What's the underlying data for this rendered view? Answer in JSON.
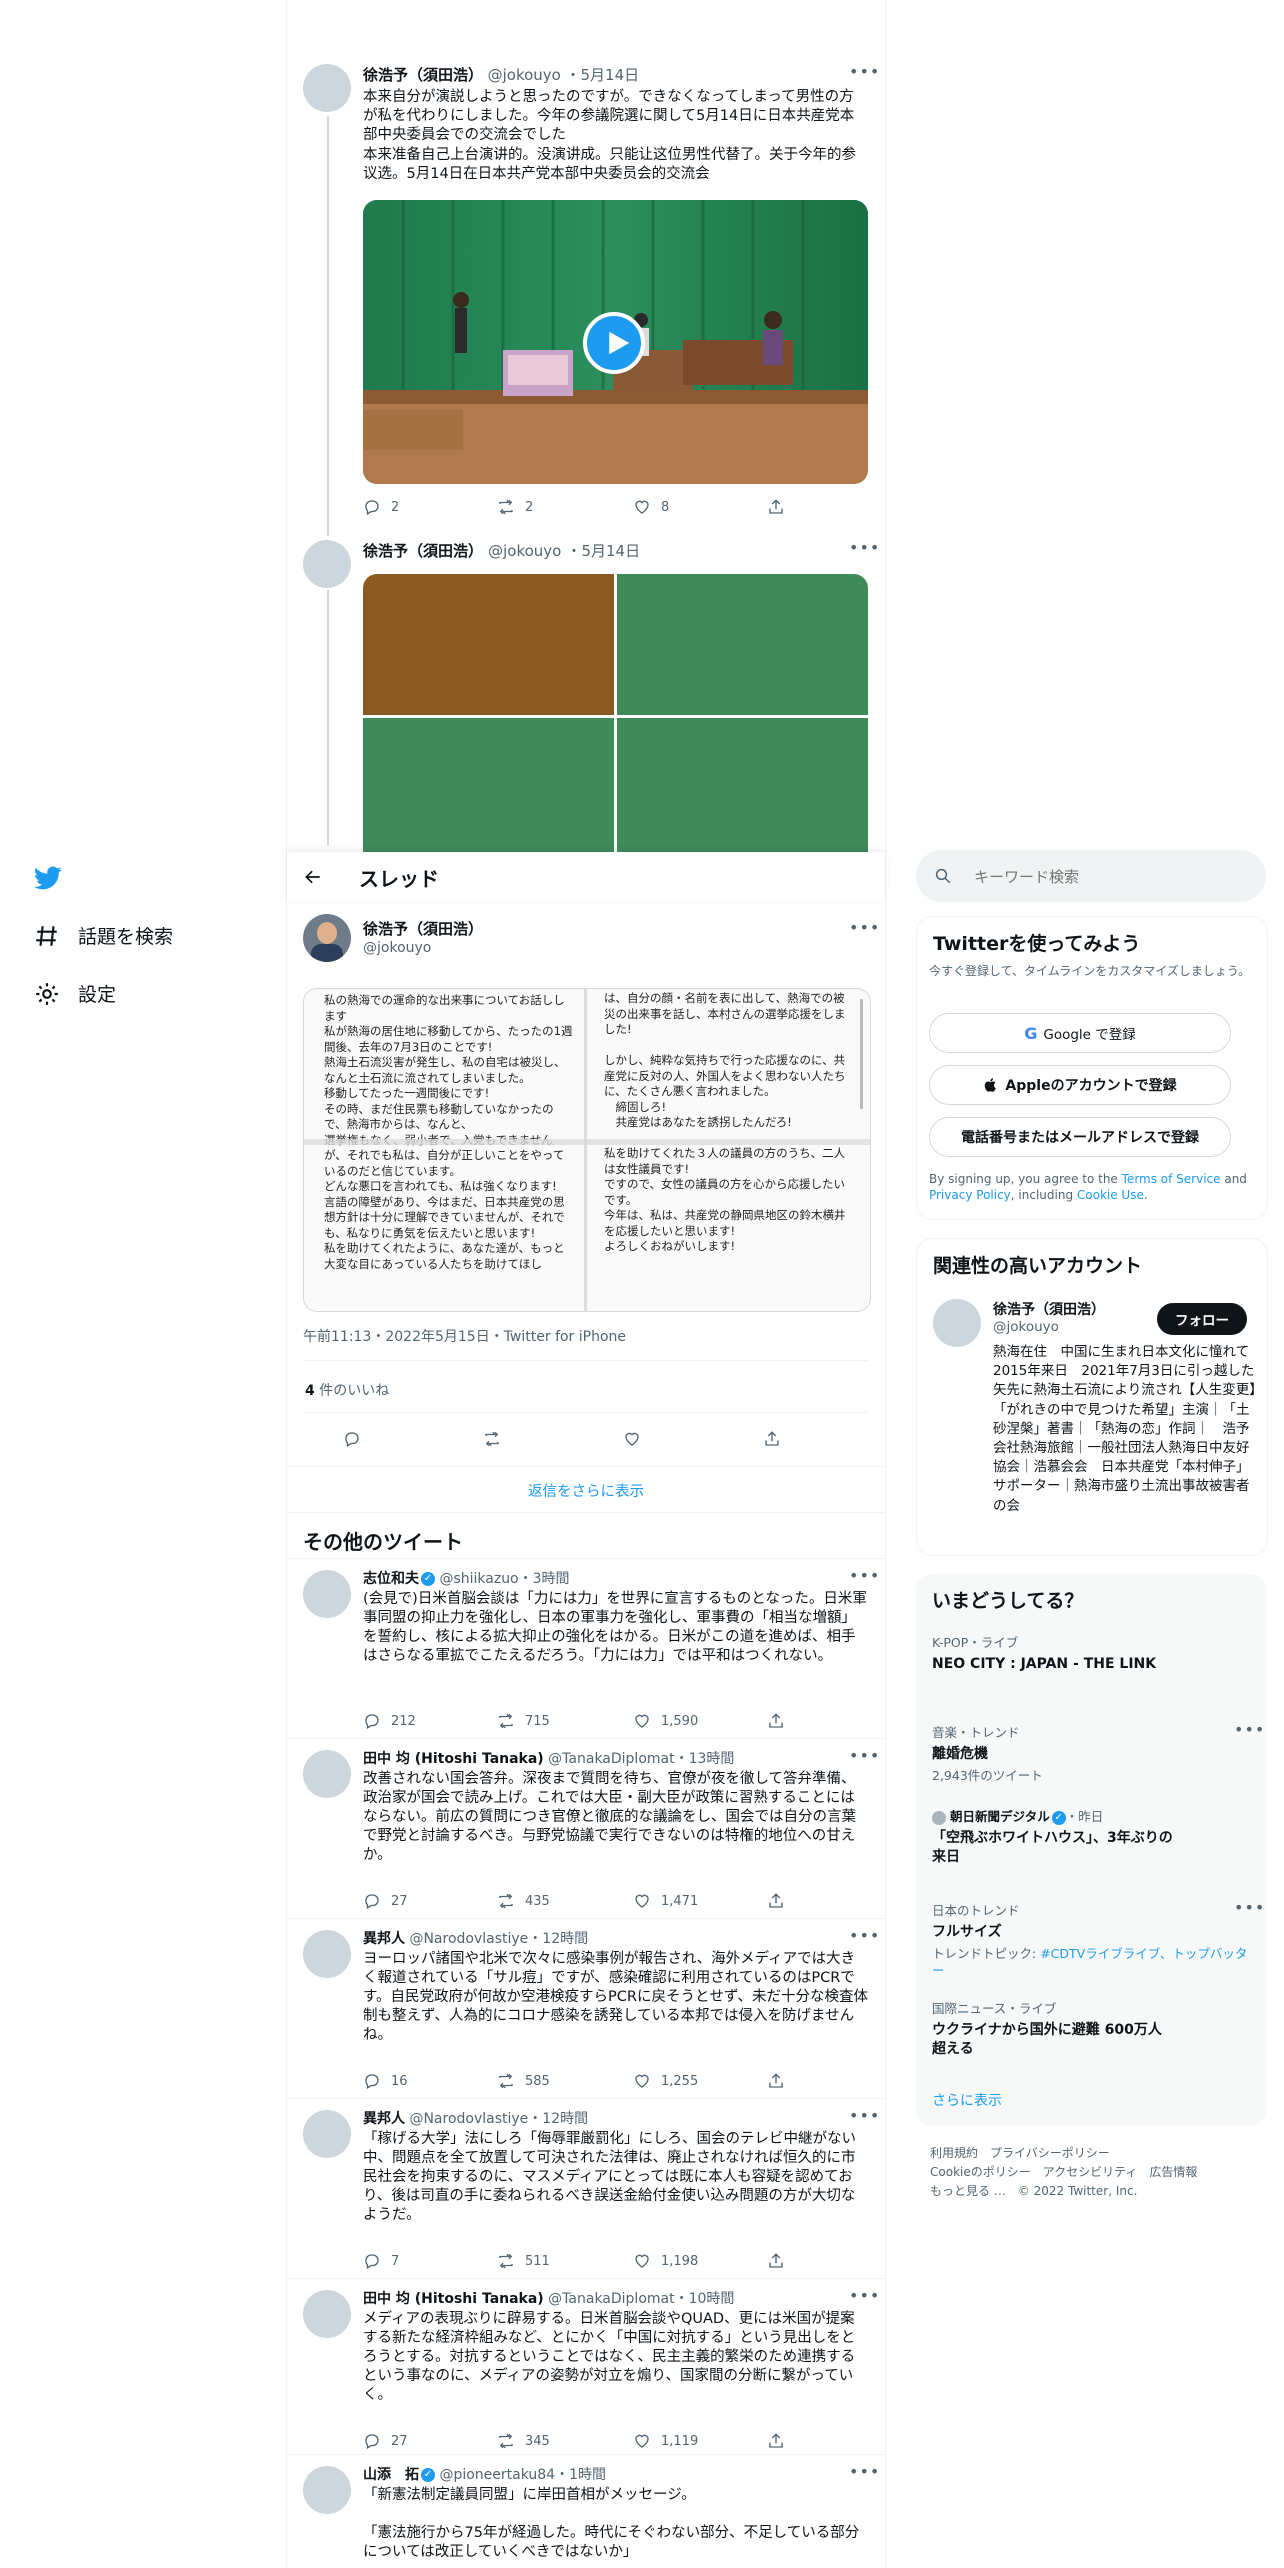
{
  "colors": {
    "accent": "#1d9bf0",
    "text": "#0f1419",
    "muted": "#536471",
    "card_bg": "#f7f9f9"
  },
  "left_nav": {
    "explore_label": "話題を検索",
    "settings_label": "設定"
  },
  "thread_top": [
    {
      "name": "徐浩予（須田浩）",
      "handle": "@jokouyo",
      "date": "5月14日",
      "text_ja": "本来自分が演説しようと思ったのですが。できなくなってしまって男性の方が私を代わりにしました。今年の参議院選に関して5月14日に日本共産党本部中央委員会での交流会でした",
      "text_zh": "本来准备自己上台演讲的。没演讲成。只能让这位男性代替了。关于今年的参议选。5月14日在日本共产党本部中央委员会的交流会",
      "reply": "2",
      "retweet": "2",
      "like": "8"
    },
    {
      "name": "徐浩予（須田浩）",
      "handle": "@jokouyo",
      "date": "5月14日"
    }
  ],
  "thread_header": {
    "title": "スレッド"
  },
  "search": {
    "placeholder": "キーワード検索"
  },
  "main_tweet": {
    "name": "徐浩予（須田浩）",
    "handle": "@jokouyo",
    "note_left": "私の熱海での運命的な出来事についてお話しします\n私が熱海の居住地に移動してから、たったの1週間後、去年の7月3日のことです!\n熱海土石流災害が発生し、私の自宅は被災し、なんと土石流に流されてしまいました。\n移動してたった一週間後にです!\nその時、まだ住民票も移動していなかったので、熱海市からは、なんと、\n選挙権もなく、弱小者で、入党もできませんが、それでも私は、自分が正しいことをやっているのだと信じています。\nどんな悪口を言われても、私は強くなります!\n言語の障壁があり、今はまだ、日本共産党の思想方針は十分に理解できていませんが、それでも、私なりに勇気を伝えたいと思います!\n私を助けてくれたように、あなた達が、もっと大変な目にあっている人たちを助けてほし",
    "note_right": "は、自分の顔・名前を表に出して、熱海での被災の出来事を話し、本村さんの選挙応援をしました!\n\nしかし、純粋な気持ちで行った応援なのに、共産党に反対の人、外国人をよく思わない人たちに、たくさん悪く言われました。\n　締固しろ!\n　共産党はあなたを誘拐したんだろ!\n\n私を助けてくれた３人の議員の方のうち、二人は女性議員です!\nですので、女性の議員の方を心から応援したいです。\n今年は、私は、共産党の静岡県地区の鈴木横井を応援したいと思います!\nよろしくおねがいします!",
    "timestamp": "午前11:13・2022年5月15日・Twitter for iPhone",
    "likes_count": "4",
    "likes_label": "件のいいね",
    "show_more_replies": "返信をさらに表示"
  },
  "more_tweets": {
    "heading": "その他のツイート",
    "items": [
      {
        "name": "志位和夫",
        "verified": true,
        "handle": "@shiikazuo",
        "time": "3時間",
        "text": "(会見で)日米首脳会談は「力には力」を世界に宣言するものとなった。日米軍事同盟の抑止力を強化し、日本の軍事力を強化し、軍事費の「相当な増額」を誓約し、核による拡大抑止の強化をはかる。日米がこの道を進めば、相手はさらなる軍拡でこたえるだろう。「力には力」では平和はつくれない。",
        "reply": "212",
        "retweet": "715",
        "like": "1,590"
      },
      {
        "name": "田中 均 (Hitoshi Tanaka)",
        "verified": false,
        "handle": "@TanakaDiplomat",
        "time": "13時間",
        "text": "改善されない国会答弁。深夜まで質問を待ち、官僚が夜を徹して答弁準備、政治家が国会で読み上げ。これでは大臣・副大臣が政策に習熟することにはならない。前広の質問につき官僚と徹底的な議論をし、国会では自分の言葉で野党と討論するべき。与野党協議で実行できないのは特権的地位への甘えか。",
        "reply": "27",
        "retweet": "435",
        "like": "1,471"
      },
      {
        "name": "異邦人",
        "verified": false,
        "handle": "@Narodovlastiye",
        "time": "12時間",
        "text": "ヨーロッパ諸国や北米で次々に感染事例が報告され、海外メディアでは大きく報道されている「サル痘」ですが、感染確認に利用されているのはPCRです。自民党政府が何故か空港検疫すらPCRに戻そうとせず、未だ十分な検査体制も整えず、人為的にコロナ感染を誘発している本邦では侵入を防げませんね。",
        "reply": "16",
        "retweet": "585",
        "like": "1,255"
      },
      {
        "name": "異邦人",
        "verified": false,
        "handle": "@Narodovlastiye",
        "time": "12時間",
        "text": "「稼げる大学」法にしろ「侮辱罪厳罰化」にしろ、国会のテレビ中継がない中、問題点を全て放置して可決された法律は、廃止されなければ恒久的に市民社会を拘束するのに、マスメディアにとっては既に本人も容疑を認めており、後は司直の手に委ねられるべき誤送金給付金使い込み問題の方が大切なようだ。",
        "reply": "7",
        "retweet": "511",
        "like": "1,198"
      },
      {
        "name": "田中 均 (Hitoshi Tanaka)",
        "verified": false,
        "handle": "@TanakaDiplomat",
        "time": "10時間",
        "text": "メディアの表現ぶりに辟易する。日米首脳会談やQUAD、更には米国が提案する新たな経済枠組みなど、とにかく「中国に対抗する」という見出しをとろうとする。対抗するということではなく、民主主義的繁栄のため連携するという事なのに、メディアの姿勢が対立を煽り、国家間の分断に繋がっていく。",
        "reply": "27",
        "retweet": "345",
        "like": "1,119"
      },
      {
        "name": "山添　拓",
        "verified": true,
        "handle": "@pioneertaku84",
        "time": "1時間",
        "text": "「新憲法制定議員同盟」に岸田首相がメッセージ。\n\n「憲法施行から75年が経過した。時代にそぐわない部分、不足している部分については改正していくべきではないか」"
      }
    ]
  },
  "signup": {
    "title": "Twitterを使ってみよう",
    "subtitle": "今すぐ登録して、タイムラインをカスタマイズしましょう。",
    "google_button": "Google で登録",
    "apple_button": "Appleのアカウントで登録",
    "phone_button": "電話番号またはメールアドレスで登録",
    "terms_prefix": "By signing up, you agree to the ",
    "terms_link": "Terms of Service",
    "terms_and": " and ",
    "privacy_link": "Privacy Policy",
    "terms_including": ", including ",
    "cookie_link": "Cookie Use",
    "terms_end": "."
  },
  "related": {
    "title": "関連性の高いアカウント",
    "name": "徐浩予（須田浩）",
    "handle": "@jokouyo",
    "follow_label": "フォロー",
    "bio": "熱海在住　中国に生まれ日本文化に憧れて2015年来日　2021年7月3日に引っ越した矢先に熱海土石流により流され【人生変更】　「がれきの中で見つけた希望」主演｜「土砂涅槃」著書｜「熱海の恋」作詞｜　浩予会社熱海旅館｜一般社団法人熱海日中友好協会｜浩慕会会　日本共産党「本村伸子」サポーター｜熱海市盛り土流出事故被害者の会"
  },
  "trends": {
    "title": "いまどうしてる？",
    "items": [
      {
        "meta": "K-POP・ライブ",
        "title": "NEO CITY : JAPAN - THE LINK"
      },
      {
        "meta": "音楽・トレンド",
        "title": "離婚危機",
        "sub": "2,943件のツイート"
      },
      {
        "meta": "朝日新聞デジタル",
        "meta_time": "・昨日",
        "title": "「空飛ぶホワイトハウス」、3年ぶりの来日"
      },
      {
        "meta": "日本のトレンド",
        "title": "フルサイズ",
        "sub_prefix": "トレンドトピック: ",
        "sub_links": "#CDTVライブライブ、トップバッター"
      },
      {
        "meta": "国際ニュース・ライブ",
        "title": "ウクライナから国外に避難 600万人超える"
      }
    ],
    "show_more": "さらに表示"
  },
  "footer": {
    "line1": "利用規約　プライバシーポリシー",
    "line2": "Cookieのポリシー　アクセシビリティ　広告情報",
    "line3": "もっと見る …　© 2022 Twitter, Inc."
  }
}
